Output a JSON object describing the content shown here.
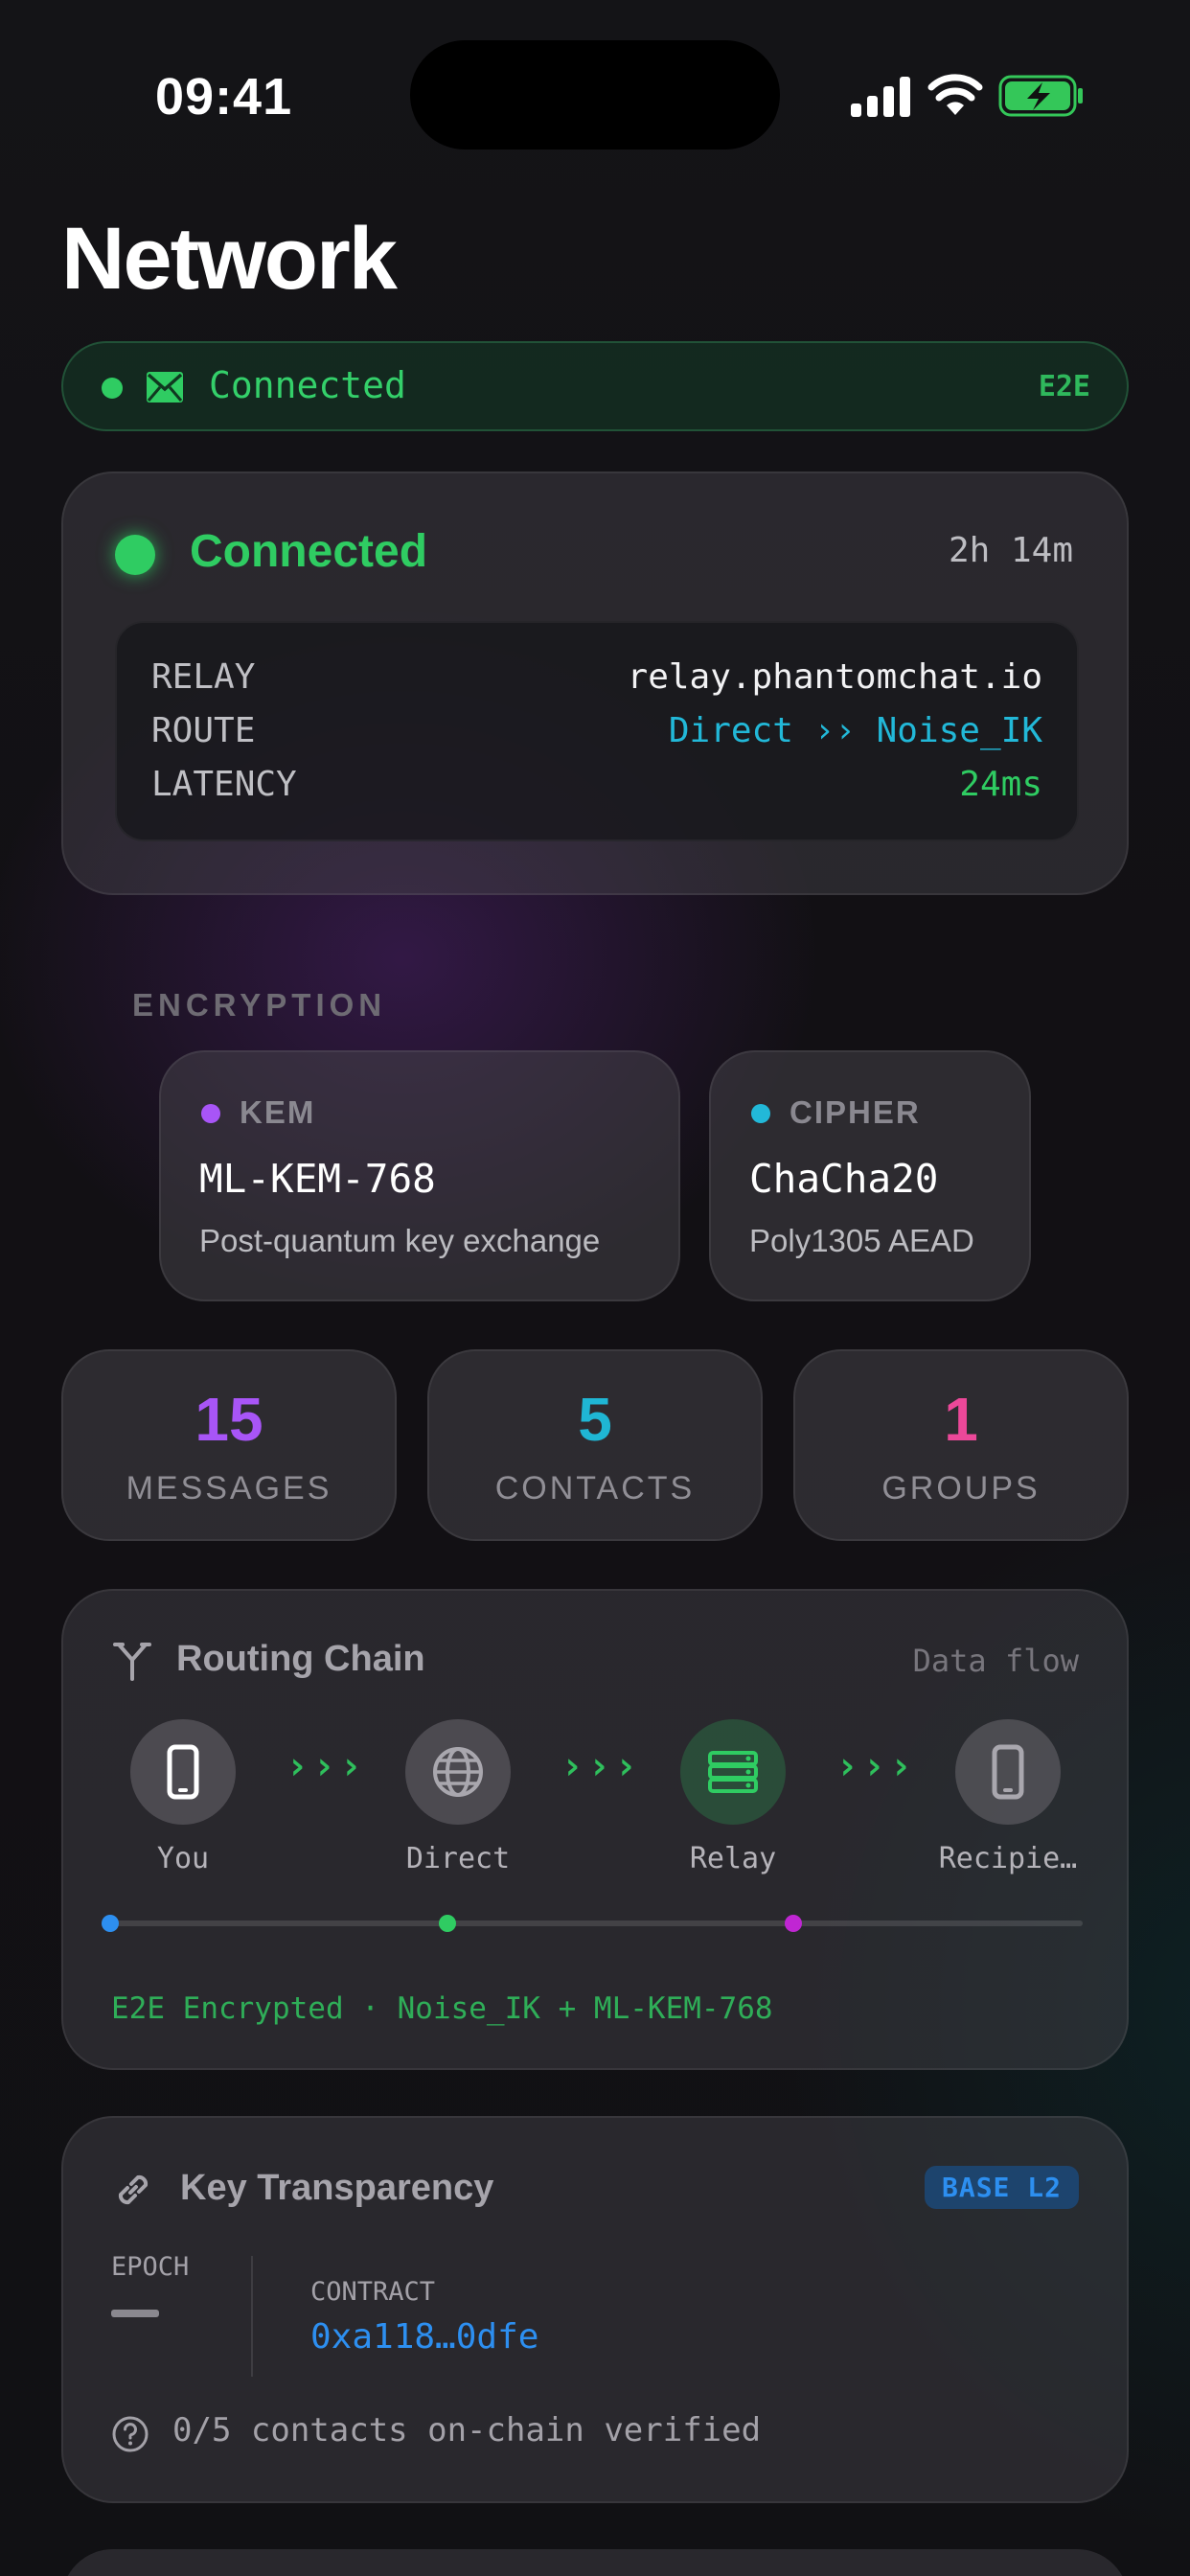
{
  "status_bar": {
    "time": "09:41"
  },
  "page": {
    "title": "Network"
  },
  "connection_pill": {
    "label": "Connected",
    "badge": "E2E"
  },
  "connection_card": {
    "status": "Connected",
    "uptime": "2h 14m",
    "relay_label": "RELAY",
    "relay_value": "relay.phantomchat.io",
    "route_label": "ROUTE",
    "route_value": "Direct ›› Noise_IK",
    "latency_label": "LATENCY",
    "latency_value": "24ms"
  },
  "encryption": {
    "section_label": "ENCRYPTION",
    "kem": {
      "tag": "KEM",
      "name": "ML-KEM-768",
      "desc": "Post-quantum key exchange",
      "color": "#a855f7"
    },
    "cipher": {
      "tag": "CIPHER",
      "name": "ChaCha20",
      "desc": "Poly1305 AEAD",
      "color": "#22b8d8"
    }
  },
  "stats": [
    {
      "value": "15",
      "label": "MESSAGES",
      "color": "#a855f7"
    },
    {
      "value": "5",
      "label": "CONTACTS",
      "color": "#1fb6d4"
    },
    {
      "value": "1",
      "label": "GROUPS",
      "color": "#ec4899"
    }
  ],
  "routing": {
    "title": "Routing Chain",
    "subtitle": "Data flow",
    "nodes": [
      "You",
      "Direct",
      "Relay",
      "Recipie…"
    ],
    "chevrons": "›››",
    "footer": "E2E Encrypted · Noise_IK + ML-KEM-768"
  },
  "key_transparency": {
    "title": "Key Transparency",
    "badge": "BASE L2",
    "epoch_label": "EPOCH",
    "contract_label": "CONTRACT",
    "contract_value": "0xa118…0dfe",
    "footer": "0/5 contacts on-chain verified"
  },
  "colors": {
    "green": "#2fcc62",
    "blue": "#2d8ff0",
    "cyan": "#22b8d8",
    "purple": "#a855f7",
    "pink": "#ec4899"
  }
}
